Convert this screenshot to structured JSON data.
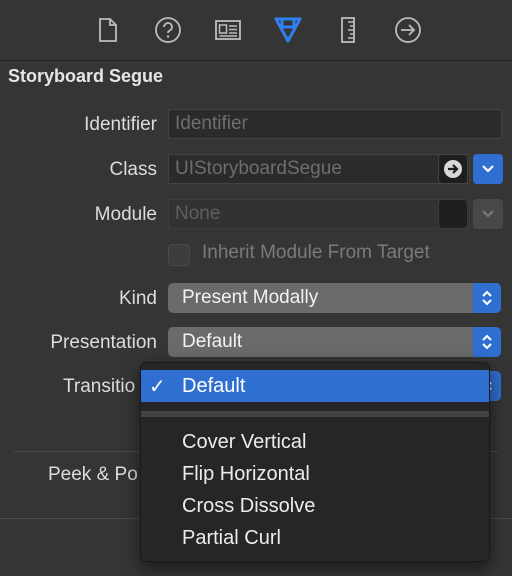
{
  "toolbar": {
    "tabs": [
      {
        "icon": "file-icon"
      },
      {
        "icon": "help-icon"
      },
      {
        "icon": "identity-card-icon"
      },
      {
        "icon": "attributes-arrow-icon",
        "active": true
      },
      {
        "icon": "ruler-icon"
      },
      {
        "icon": "connections-arrow-icon"
      }
    ],
    "accent_color": "#2f7ff0"
  },
  "section": {
    "title": "Storyboard Segue"
  },
  "fields": {
    "identifier": {
      "label": "Identifier",
      "placeholder": "Identifier"
    },
    "class": {
      "label": "Class",
      "placeholder": "UIStoryboardSegue"
    },
    "module": {
      "label": "Module",
      "placeholder": "None"
    },
    "inherit": {
      "label": "Inherit Module From Target"
    },
    "kind": {
      "label": "Kind",
      "value": "Present Modally"
    },
    "presentation": {
      "label": "Presentation",
      "value": "Default"
    },
    "transition": {
      "label": "Transitio"
    },
    "peek": {
      "label": "Peek & Po"
    }
  },
  "menu": {
    "selected": "Default",
    "check": "✓",
    "items": [
      "Cover Vertical",
      "Flip Horizontal",
      "Cross Dissolve",
      "Partial Curl"
    ]
  },
  "colors": {
    "selection": "#2f6fd0",
    "background": "#353536"
  }
}
